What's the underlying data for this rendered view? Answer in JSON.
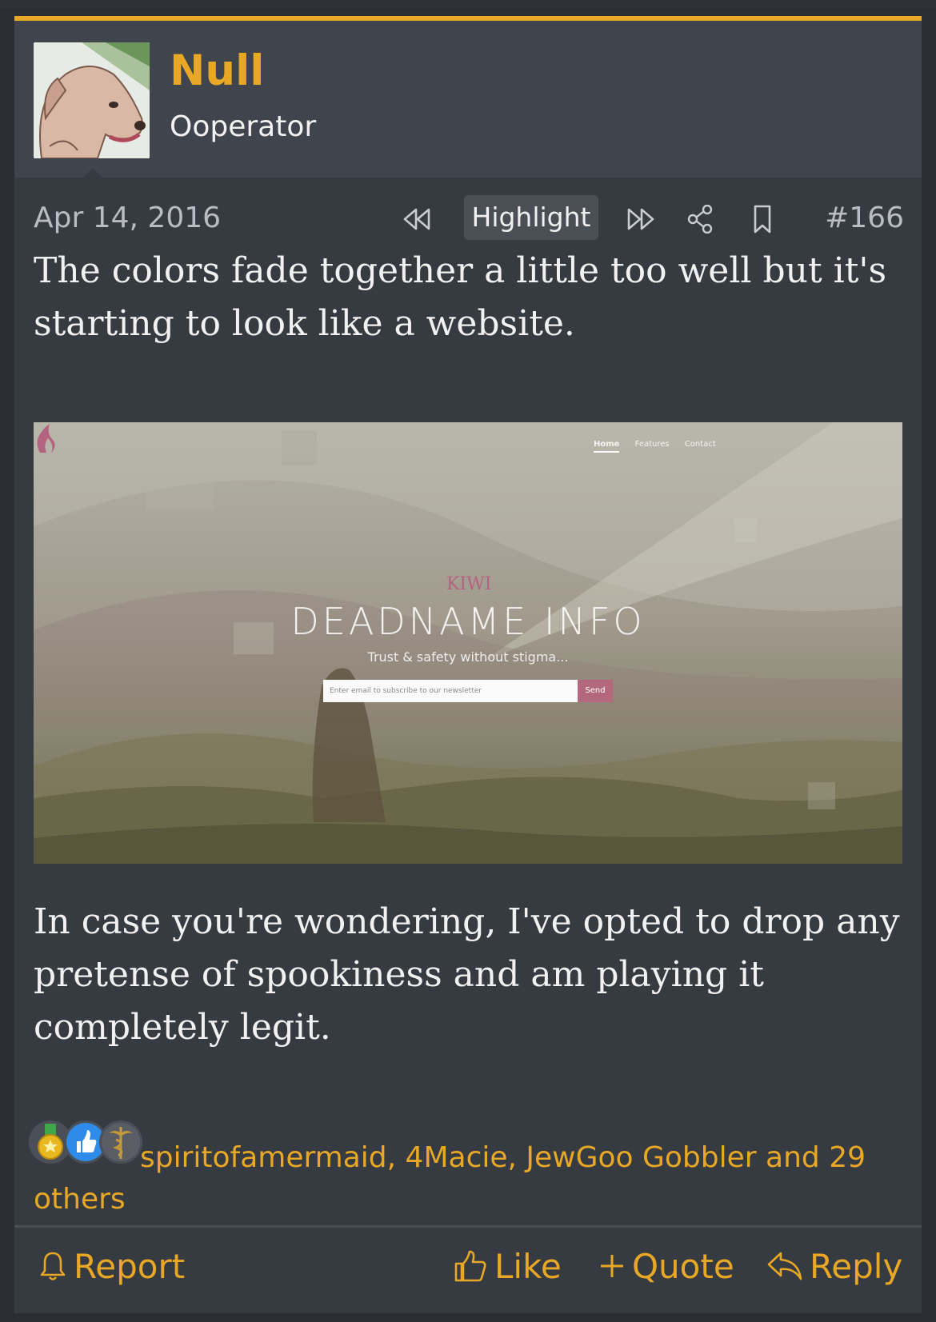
{
  "user": {
    "name": "Null",
    "title": "Ooperator"
  },
  "meta": {
    "date": "Apr 14, 2016",
    "highlight_label": "Highlight",
    "post_number": "#166"
  },
  "post": {
    "paragraph1": "The colors fade together a little too well but it's starting to look like a website.",
    "paragraph2": "In case you're wondering, I've opted to drop any pretense of spookiness and am playing it completely legit."
  },
  "embedded_screenshot": {
    "nav": [
      "Home",
      "Features",
      "Contact"
    ],
    "logo_text": "KIWI",
    "title": "DEADNAME INFO",
    "subtitle": "Trust & safety without stigma...",
    "input_placeholder": "Enter email to subscribe to our newsletter",
    "send_label": "Send"
  },
  "reactions": {
    "icons": [
      "medal-icon",
      "thumbs-up-icon",
      "caduceus-icon"
    ],
    "text": "spiritofamermaid, 4Macie, JewGoo Gobbler and 29 others"
  },
  "footer": {
    "report": "Report",
    "like": "Like",
    "quote": "Quote",
    "reply": "Reply"
  },
  "colors": {
    "accent": "#e8a825",
    "background": "#363a41",
    "header_bg": "#40444c"
  }
}
